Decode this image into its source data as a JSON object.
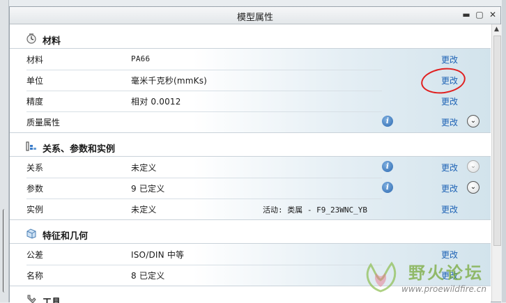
{
  "window": {
    "title": "模型属性"
  },
  "sections": {
    "materials": {
      "title": "材料",
      "rows": [
        {
          "name": "材料",
          "value": "PA66",
          "action": "更改"
        },
        {
          "name": "单位",
          "value": "毫米千克秒(mmKs)",
          "action": "更改"
        },
        {
          "name": "精度",
          "value": "相对 0.0012",
          "action": "更改"
        },
        {
          "name": "质量属性",
          "value": "",
          "action": "更改"
        }
      ]
    },
    "relations": {
      "title": "关系、参数和实例",
      "rows": [
        {
          "name": "关系",
          "value": "未定义",
          "action": "更改"
        },
        {
          "name": "参数",
          "value": "9 已定义",
          "action": "更改"
        },
        {
          "name": "实例",
          "value": "未定义",
          "extra": "活动: 类属 - F9_23WNC_YB",
          "action": "更改"
        }
      ]
    },
    "features": {
      "title": "特征和几何",
      "rows": [
        {
          "name": "公差",
          "value": "ISO/DIN 中等",
          "action": "更改"
        },
        {
          "name": "名称",
          "value": "8 已定义",
          "action": "更改"
        }
      ]
    },
    "tools": {
      "title": "工具"
    }
  },
  "watermark": {
    "text": "野火论坛",
    "url": "www.proewildfire.cn"
  },
  "icons": {
    "info": "info-icon",
    "expand": "chevron-down-icon",
    "minimize": "minimize-icon",
    "maximize": "maximize-icon",
    "close": "close-icon"
  },
  "colors": {
    "link": "#1e63b5",
    "annotation": "#e02020"
  }
}
